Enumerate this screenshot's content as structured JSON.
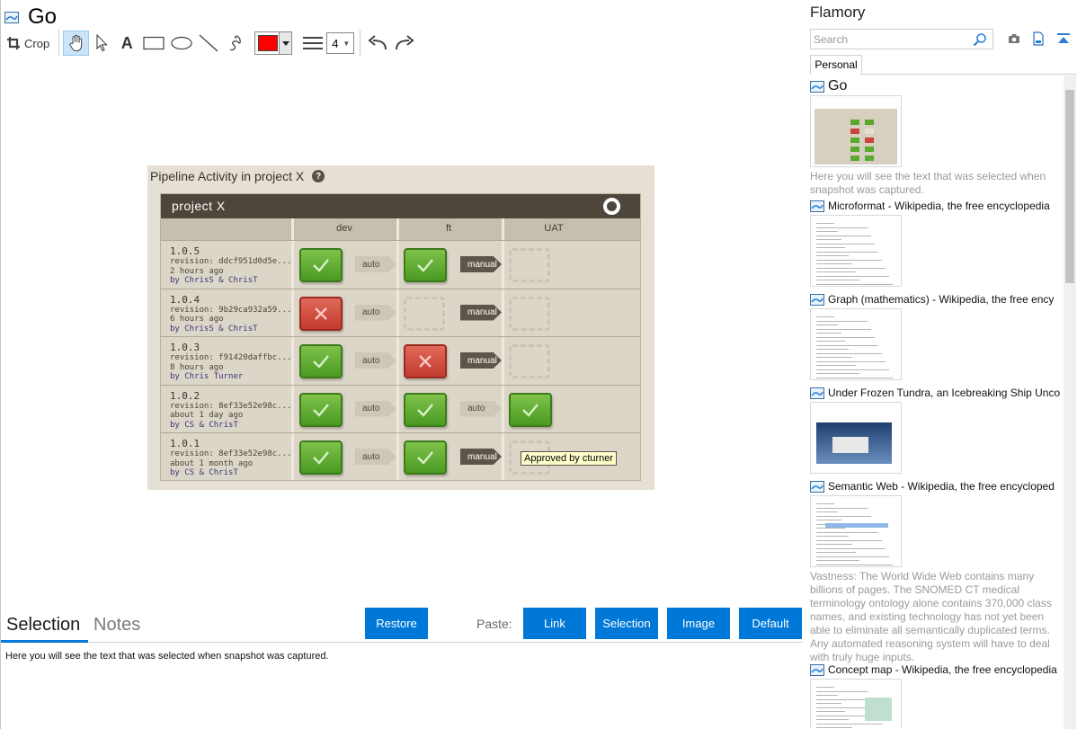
{
  "window": {
    "title": "Go"
  },
  "toolbar": {
    "crop_label": "Crop",
    "text_tool_glyph": "A",
    "line_width_value": "4",
    "color": "#ff0000",
    "tools": [
      "crop-icon",
      "hand-icon",
      "pointer-icon",
      "text-icon",
      "rectangle-icon",
      "ellipse-icon",
      "line-icon",
      "freehand-icon",
      "color-picker",
      "line-width-icon",
      "undo-icon",
      "redo-icon"
    ]
  },
  "snapshot": {
    "heading": "Pipeline Activity in project X",
    "help_glyph": "?",
    "project": "project X",
    "stages": [
      "dev",
      "ft",
      "UAT"
    ],
    "rows": [
      {
        "label": "1.0.5",
        "revision": "revision: ddcf951d0d5e...",
        "time": "2 hours ago",
        "by": "by ChrisS & ChrisT",
        "dev": "pass",
        "gate1": "auto",
        "ft": "pass",
        "gate2": "manual",
        "uat": "empty"
      },
      {
        "label": "1.0.4",
        "revision": "revision: 9b29ca932a59...",
        "time": "6 hours ago",
        "by": "by ChrisS & ChrisT",
        "dev": "fail",
        "gate1": "auto",
        "ft": "empty",
        "gate2": "manual",
        "uat": "empty"
      },
      {
        "label": "1.0.3",
        "revision": "revision: f91420daffbc...",
        "time": "8 hours ago",
        "by": "by Chris Turner",
        "dev": "pass",
        "gate1": "auto",
        "ft": "fail",
        "gate2": "manual",
        "uat": "empty"
      },
      {
        "label": "1.0.2",
        "revision": "revision: 8ef33e52e98c...",
        "time": "about 1 day ago",
        "by": "by CS & ChrisT",
        "dev": "pass",
        "gate1": "auto",
        "ft": "pass",
        "gate2": "auto",
        "uat": "pass"
      },
      {
        "label": "1.0.1",
        "revision": "revision: 8ef33e52e98c...",
        "time": "about 1 month ago",
        "by": "by CS & ChrisT",
        "dev": "pass",
        "gate1": "auto",
        "ft": "pass",
        "gate2": "manual",
        "uat": "empty"
      }
    ],
    "tooltip": "Approved by cturner"
  },
  "bottom": {
    "tab_selection": "Selection",
    "tab_notes": "Notes",
    "restore_label": "Restore",
    "paste_label": "Paste:",
    "paste_buttons": [
      "Link",
      "Selection",
      "Image",
      "Default"
    ],
    "selection_text": "Here you will see the text that was selected when snapshot was captured."
  },
  "sidebar": {
    "title": "Flamory",
    "search_placeholder": "Search",
    "tab_personal": "Personal",
    "entries": [
      {
        "title": "Go",
        "note": "Here you will see the text that was selected when snapshot was captured."
      },
      {
        "title": "Microformat - Wikipedia, the free encyclopedia",
        "note": ""
      },
      {
        "title": "Graph (mathematics) - Wikipedia, the free ency",
        "note": ""
      },
      {
        "title": "Under Frozen Tundra, an Icebreaking Ship Unco",
        "note": ""
      },
      {
        "title": "Semantic Web - Wikipedia, the free encycloped",
        "note": "Vastness: The World Wide Web contains many billions of pages. The SNOMED CT medical terminology ontology alone contains 370,000 class names, and existing technology has not yet been able to eliminate all semantically duplicated terms. Any automated reasoning system will have to deal with truly huge inputs."
      },
      {
        "title": "Concept map - Wikipedia, the free encyclopedia",
        "note": ""
      }
    ]
  },
  "colors": {
    "accent": "#0078d7",
    "pass": "#5aa82e",
    "fail": "#c9443a"
  }
}
